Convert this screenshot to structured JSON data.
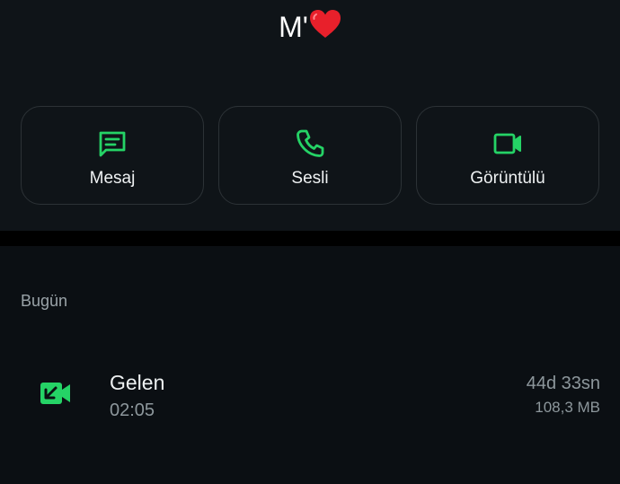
{
  "header": {
    "contact_name": "M'",
    "heart_icon": "red-heart-emoji"
  },
  "actions": [
    {
      "label": "Mesaj",
      "icon": "message-icon"
    },
    {
      "label": "Sesli",
      "icon": "phone-icon"
    },
    {
      "label": "Görüntülü",
      "icon": "video-camera-icon"
    }
  ],
  "section": {
    "title": "Bugün"
  },
  "call": {
    "type": "Gelen",
    "time": "02:05",
    "duration": "44d 33sn",
    "size": "108,3 MB",
    "icon": "incoming-video-call-icon"
  },
  "colors": {
    "accent": "#25d366",
    "heart": "#e8202b",
    "background": "#0b0f13",
    "panel": "#0f1418"
  }
}
